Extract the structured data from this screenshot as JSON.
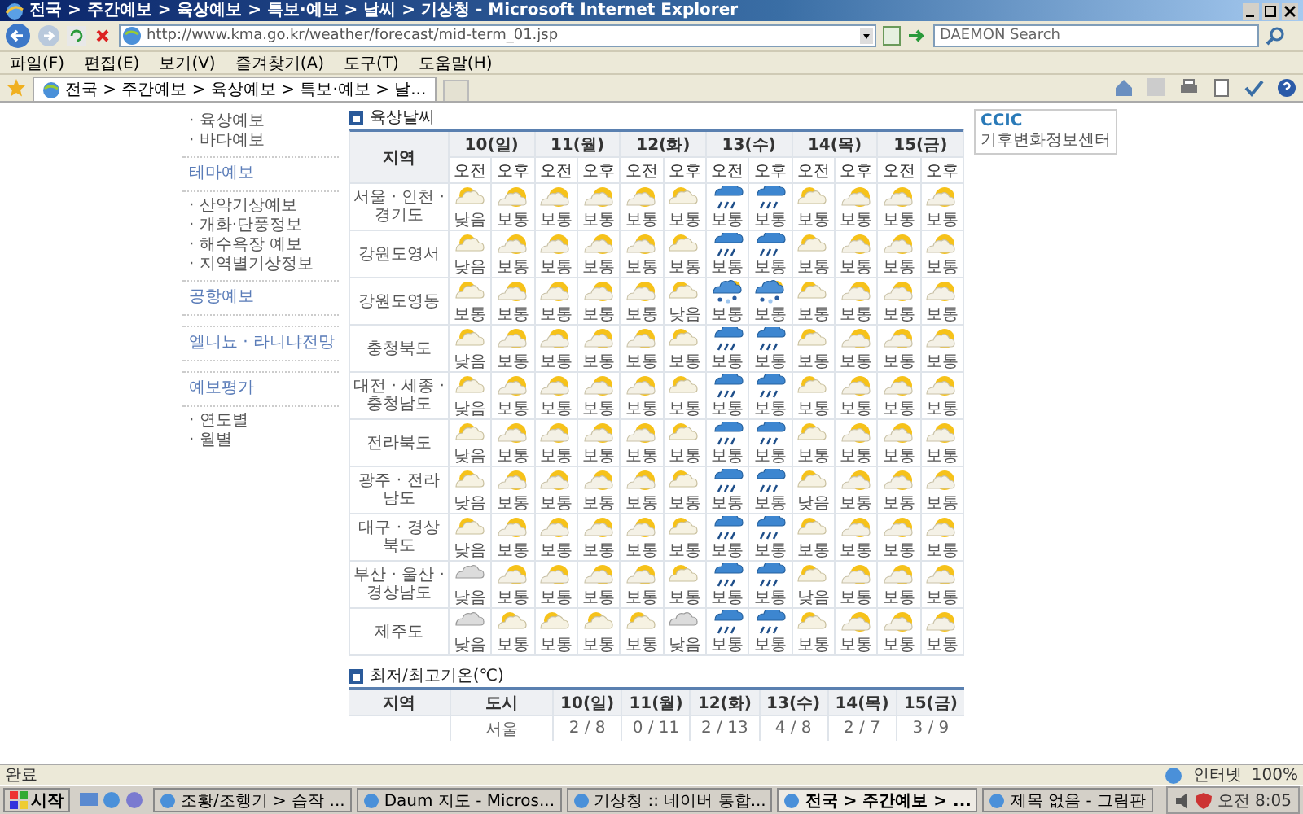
{
  "window": {
    "title": "전국 > 주간예보 > 육상예보 > 특보·예보 > 날씨 > 기상청 - Microsoft Internet Explorer"
  },
  "address_bar": {
    "value": "http://www.kma.go.kr/weather/forecast/mid-term_01.jsp"
  },
  "search": {
    "placeholder": "DAEMON Search"
  },
  "menu": [
    "파일(F)",
    "편집(E)",
    "보기(V)",
    "즐겨찾기(A)",
    "도구(T)",
    "도움말(H)"
  ],
  "tabs": [
    {
      "label": "전국 > 주간예보 > 육상예보 > 특보·예보 > 날...",
      "selected": true
    }
  ],
  "sidebar": {
    "items": [
      {
        "kind": "item",
        "label": "· 육상예보"
      },
      {
        "kind": "item",
        "label": "· 바다예보"
      },
      {
        "kind": "heading",
        "label": "테마예보"
      },
      {
        "kind": "item",
        "label": "· 산악기상예보"
      },
      {
        "kind": "item",
        "label": "· 개화·단풍정보"
      },
      {
        "kind": "item",
        "label": "· 해수욕장 예보"
      },
      {
        "kind": "item",
        "label": "· 지역별기상정보"
      },
      {
        "kind": "heading",
        "label": "공항예보"
      },
      {
        "kind": "heading",
        "label": "엘니뇨 · 라니냐전망"
      },
      {
        "kind": "heading",
        "label": "예보평가"
      },
      {
        "kind": "item",
        "label": "· 연도별"
      },
      {
        "kind": "item",
        "label": "· 월별"
      }
    ]
  },
  "forecast": {
    "title": "육상날씨",
    "region_header": "지역",
    "days": [
      {
        "label": "10(일)",
        "periods": [
          "오전",
          "오후"
        ]
      },
      {
        "label": "11(월)",
        "periods": [
          "오전",
          "오후"
        ]
      },
      {
        "label": "12(화)",
        "periods": [
          "오전",
          "오후"
        ]
      },
      {
        "label": "13(수)",
        "periods": [
          "오전",
          "오후"
        ]
      },
      {
        "label": "14(목)",
        "periods": [
          "오전",
          "오후"
        ]
      },
      {
        "label": "15(금)",
        "periods": [
          "오전",
          "오후"
        ]
      }
    ],
    "rows": [
      {
        "region": "서울 · 인천 · 경기도",
        "cells": [
          {
            "kind": "mostly_cloudy",
            "text": "낮음"
          },
          {
            "kind": "partly_cloudy",
            "text": "보통"
          },
          {
            "kind": "partly_cloudy",
            "text": "보통"
          },
          {
            "kind": "partly_cloudy",
            "text": "보통"
          },
          {
            "kind": "partly_cloudy",
            "text": "보통"
          },
          {
            "kind": "mostly_cloudy",
            "text": "보통"
          },
          {
            "kind": "rain",
            "text": "보통"
          },
          {
            "kind": "rain",
            "text": "보통"
          },
          {
            "kind": "mostly_cloudy",
            "text": "보통"
          },
          {
            "kind": "partly_cloudy",
            "text": "보통"
          },
          {
            "kind": "partly_cloudy",
            "text": "보통"
          },
          {
            "kind": "partly_cloudy",
            "text": "보통"
          }
        ]
      },
      {
        "region": "강원도영서",
        "cells": [
          {
            "kind": "mostly_cloudy",
            "text": "낮음"
          },
          {
            "kind": "partly_cloudy",
            "text": "보통"
          },
          {
            "kind": "partly_cloudy",
            "text": "보통"
          },
          {
            "kind": "partly_cloudy",
            "text": "보통"
          },
          {
            "kind": "partly_cloudy",
            "text": "보통"
          },
          {
            "kind": "mostly_cloudy",
            "text": "보통"
          },
          {
            "kind": "rain",
            "text": "보통"
          },
          {
            "kind": "rain",
            "text": "보통"
          },
          {
            "kind": "mostly_cloudy",
            "text": "보통"
          },
          {
            "kind": "partly_cloudy",
            "text": "보통"
          },
          {
            "kind": "partly_cloudy",
            "text": "보통"
          },
          {
            "kind": "partly_cloudy",
            "text": "보통"
          }
        ]
      },
      {
        "region": "강원도영동",
        "cells": [
          {
            "kind": "mostly_cloudy",
            "text": "보통"
          },
          {
            "kind": "partly_cloudy",
            "text": "보통"
          },
          {
            "kind": "partly_cloudy",
            "text": "보통"
          },
          {
            "kind": "partly_cloudy",
            "text": "보통"
          },
          {
            "kind": "partly_cloudy",
            "text": "보통"
          },
          {
            "kind": "mostly_cloudy",
            "text": "낮음"
          },
          {
            "kind": "rain_snow",
            "text": "보통"
          },
          {
            "kind": "rain_snow",
            "text": "보통"
          },
          {
            "kind": "mostly_cloudy",
            "text": "보통"
          },
          {
            "kind": "partly_cloudy",
            "text": "보통"
          },
          {
            "kind": "partly_cloudy",
            "text": "보통"
          },
          {
            "kind": "partly_cloudy",
            "text": "보통"
          }
        ]
      },
      {
        "region": "충청북도",
        "cells": [
          {
            "kind": "mostly_cloudy",
            "text": "낮음"
          },
          {
            "kind": "partly_cloudy",
            "text": "보통"
          },
          {
            "kind": "partly_cloudy",
            "text": "보통"
          },
          {
            "kind": "partly_cloudy",
            "text": "보통"
          },
          {
            "kind": "partly_cloudy",
            "text": "보통"
          },
          {
            "kind": "mostly_cloudy",
            "text": "보통"
          },
          {
            "kind": "rain",
            "text": "보통"
          },
          {
            "kind": "rain",
            "text": "보통"
          },
          {
            "kind": "mostly_cloudy",
            "text": "보통"
          },
          {
            "kind": "partly_cloudy",
            "text": "보통"
          },
          {
            "kind": "partly_cloudy",
            "text": "보통"
          },
          {
            "kind": "partly_cloudy",
            "text": "보통"
          }
        ]
      },
      {
        "region": "대전 · 세종 · 충청남도",
        "cells": [
          {
            "kind": "mostly_cloudy",
            "text": "낮음"
          },
          {
            "kind": "partly_cloudy",
            "text": "보통"
          },
          {
            "kind": "partly_cloudy",
            "text": "보통"
          },
          {
            "kind": "partly_cloudy",
            "text": "보통"
          },
          {
            "kind": "partly_cloudy",
            "text": "보통"
          },
          {
            "kind": "mostly_cloudy",
            "text": "보통"
          },
          {
            "kind": "rain",
            "text": "보통"
          },
          {
            "kind": "rain",
            "text": "보통"
          },
          {
            "kind": "mostly_cloudy",
            "text": "보통"
          },
          {
            "kind": "partly_cloudy",
            "text": "보통"
          },
          {
            "kind": "partly_cloudy",
            "text": "보통"
          },
          {
            "kind": "partly_cloudy",
            "text": "보통"
          }
        ]
      },
      {
        "region": "전라북도",
        "cells": [
          {
            "kind": "mostly_cloudy",
            "text": "낮음"
          },
          {
            "kind": "partly_cloudy",
            "text": "보통"
          },
          {
            "kind": "partly_cloudy",
            "text": "보통"
          },
          {
            "kind": "partly_cloudy",
            "text": "보통"
          },
          {
            "kind": "partly_cloudy",
            "text": "보통"
          },
          {
            "kind": "mostly_cloudy",
            "text": "보통"
          },
          {
            "kind": "rain",
            "text": "보통"
          },
          {
            "kind": "rain",
            "text": "보통"
          },
          {
            "kind": "mostly_cloudy",
            "text": "보통"
          },
          {
            "kind": "partly_cloudy",
            "text": "보통"
          },
          {
            "kind": "partly_cloudy",
            "text": "보통"
          },
          {
            "kind": "partly_cloudy",
            "text": "보통"
          }
        ]
      },
      {
        "region": "광주 · 전라남도",
        "cells": [
          {
            "kind": "mostly_cloudy",
            "text": "낮음"
          },
          {
            "kind": "partly_cloudy",
            "text": "보통"
          },
          {
            "kind": "partly_cloudy",
            "text": "보통"
          },
          {
            "kind": "partly_cloudy",
            "text": "보통"
          },
          {
            "kind": "partly_cloudy",
            "text": "보통"
          },
          {
            "kind": "mostly_cloudy",
            "text": "보통"
          },
          {
            "kind": "rain",
            "text": "보통"
          },
          {
            "kind": "rain",
            "text": "보통"
          },
          {
            "kind": "mostly_cloudy",
            "text": "낮음"
          },
          {
            "kind": "partly_cloudy",
            "text": "보통"
          },
          {
            "kind": "partly_cloudy",
            "text": "보통"
          },
          {
            "kind": "partly_cloudy",
            "text": "보통"
          }
        ]
      },
      {
        "region": "대구 · 경상북도",
        "cells": [
          {
            "kind": "mostly_cloudy",
            "text": "낮음"
          },
          {
            "kind": "partly_cloudy",
            "text": "보통"
          },
          {
            "kind": "partly_cloudy",
            "text": "보통"
          },
          {
            "kind": "partly_cloudy",
            "text": "보통"
          },
          {
            "kind": "partly_cloudy",
            "text": "보통"
          },
          {
            "kind": "mostly_cloudy",
            "text": "보통"
          },
          {
            "kind": "rain",
            "text": "보통"
          },
          {
            "kind": "rain",
            "text": "보통"
          },
          {
            "kind": "mostly_cloudy",
            "text": "보통"
          },
          {
            "kind": "partly_cloudy",
            "text": "보통"
          },
          {
            "kind": "partly_cloudy",
            "text": "보통"
          },
          {
            "kind": "partly_cloudy",
            "text": "보통"
          }
        ]
      },
      {
        "region": "부산 · 울산 · 경상남도",
        "cells": [
          {
            "kind": "overcast",
            "text": "낮음"
          },
          {
            "kind": "partly_cloudy",
            "text": "보통"
          },
          {
            "kind": "partly_cloudy",
            "text": "보통"
          },
          {
            "kind": "partly_cloudy",
            "text": "보통"
          },
          {
            "kind": "partly_cloudy",
            "text": "보통"
          },
          {
            "kind": "mostly_cloudy",
            "text": "보통"
          },
          {
            "kind": "rain",
            "text": "보통"
          },
          {
            "kind": "rain",
            "text": "보통"
          },
          {
            "kind": "mostly_cloudy",
            "text": "낮음"
          },
          {
            "kind": "partly_cloudy",
            "text": "보통"
          },
          {
            "kind": "partly_cloudy",
            "text": "보통"
          },
          {
            "kind": "partly_cloudy",
            "text": "보통"
          }
        ]
      },
      {
        "region": "제주도",
        "cells": [
          {
            "kind": "overcast",
            "text": "낮음"
          },
          {
            "kind": "mostly_cloudy",
            "text": "보통"
          },
          {
            "kind": "mostly_cloudy",
            "text": "보통"
          },
          {
            "kind": "mostly_cloudy",
            "text": "보통"
          },
          {
            "kind": "mostly_cloudy",
            "text": "보통"
          },
          {
            "kind": "overcast",
            "text": "낮음"
          },
          {
            "kind": "rain",
            "text": "보통"
          },
          {
            "kind": "rain",
            "text": "보통"
          },
          {
            "kind": "mostly_cloudy",
            "text": "보통"
          },
          {
            "kind": "partly_cloudy",
            "text": "보통"
          },
          {
            "kind": "partly_cloudy",
            "text": "보통"
          },
          {
            "kind": "partly_cloudy",
            "text": "보통"
          }
        ]
      }
    ]
  },
  "temperature": {
    "title": "최저/최고기온(℃)",
    "columns": [
      "지역",
      "도시",
      "10(일)",
      "11(월)",
      "12(화)",
      "13(수)",
      "14(목)",
      "15(금)"
    ],
    "rows": [
      {
        "city": "서울",
        "values": [
          "2 / 8",
          "0 / 11",
          "2 / 13",
          "4 / 8",
          "2 / 7",
          "3 / 9"
        ]
      }
    ]
  },
  "logo": {
    "mark": "CCIC",
    "name": "기후변화정보센터"
  },
  "status_bar": {
    "text": "완료",
    "zone": "인터넷",
    "zoom": "100%"
  },
  "taskbar": {
    "start": "시작",
    "items": [
      {
        "label": "조황/조행기 > 습작 ...",
        "selected": false
      },
      {
        "label": "Daum 지도 - Micros...",
        "selected": false
      },
      {
        "label": "기상청 :: 네이버 통합...",
        "selected": false
      },
      {
        "label": "전국 > 주간예보 > ...",
        "selected": true
      },
      {
        "label": "제목 없음 - 그림판",
        "selected": false
      }
    ],
    "clock": "오전 8:05"
  }
}
